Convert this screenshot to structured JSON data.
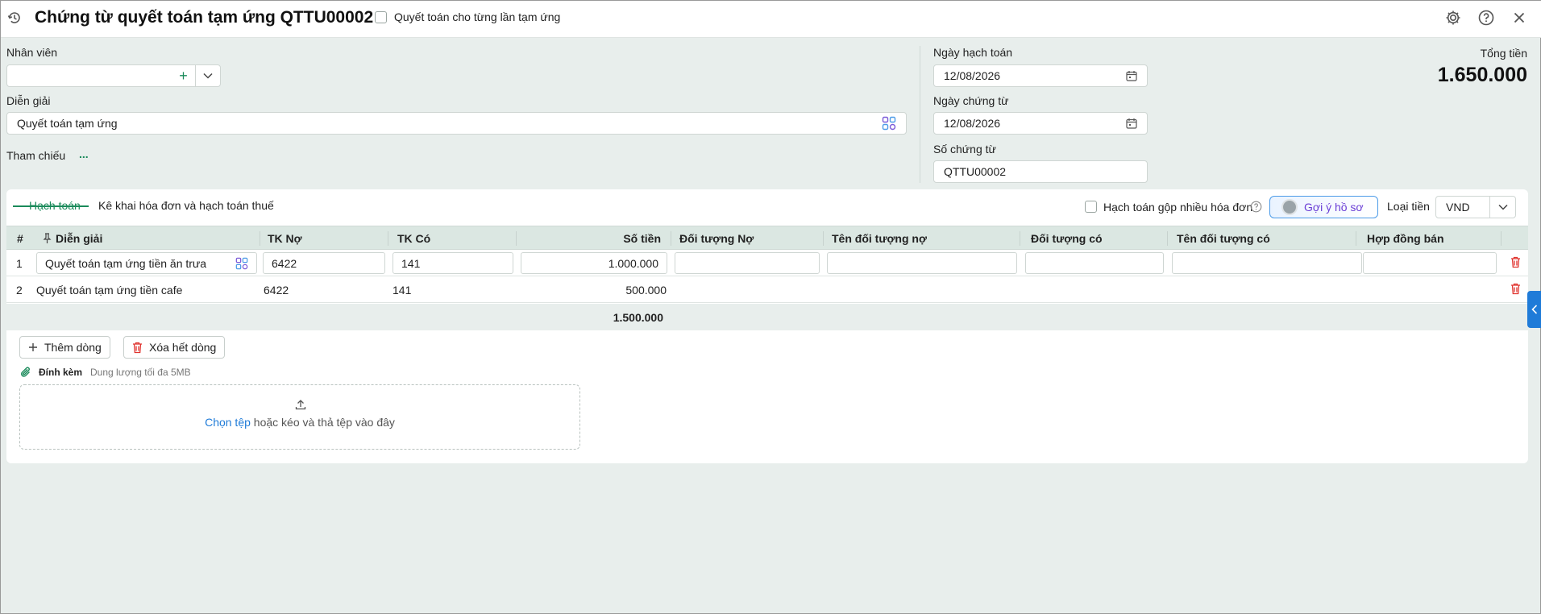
{
  "header": {
    "title": "Chứng từ quyết toán tạm ứng QTTU00002",
    "checkbox_label": "Quyết toán cho từng lần tạm ứng"
  },
  "form": {
    "employee_label": "Nhân viên",
    "employee_value": "",
    "description_label": "Diễn giải",
    "description_value": "Quyết toán tạm ứng",
    "reference_label": "Tham chiếu",
    "reference_more": "...",
    "posting_date_label": "Ngày hạch toán",
    "posting_date_value": "12/08/2026",
    "voucher_date_label": "Ngày chứng từ",
    "voucher_date_value": "12/08/2026",
    "voucher_no_label": "Số chứng từ",
    "voucher_no_value": "QTTU00002",
    "total_label": "Tổng tiền",
    "total_value": "1.650.000"
  },
  "tabs": [
    {
      "label": "Hạch toán"
    },
    {
      "label": "Kê khai hóa đơn và hạch toán thuế"
    }
  ],
  "toolbar": {
    "merge_label": "Hạch toán gộp nhiều hóa đơn",
    "suggest_label": "Gợi ý hồ sơ",
    "currency_label": "Loại tiền",
    "currency_value": "VND"
  },
  "table": {
    "headers": [
      "#",
      "Diễn giải",
      "TK Nợ",
      "TK Có",
      "Số tiền",
      "Đối tượng Nợ",
      "Tên đối tượng nợ",
      "Đối tượng có",
      "Tên đối tượng có",
      "Hợp đồng bán"
    ],
    "rows": [
      {
        "no": "1",
        "desc": "Quyết toán tạm ứng tiền ăn trưa",
        "debit": "6422",
        "credit": "141",
        "amount": "1.000.000"
      },
      {
        "no": "2",
        "desc": "Quyết toán tạm ứng tiền cafe",
        "debit": "6422",
        "credit": "141",
        "amount": "500.000"
      }
    ],
    "sum_amount": "1.500.000"
  },
  "actions": {
    "add_row": "Thêm dòng",
    "delete_all": "Xóa hết dòng"
  },
  "attachment": {
    "label": "Đính kèm",
    "hint": "Dung lượng tối đa 5MB",
    "choose": "Chọn tệp",
    "drop_text": " hoặc kéo và thả tệp vào đây"
  },
  "colors": {
    "accent_green": "#1a8a5a",
    "link_blue": "#1f7bd8",
    "delete_red": "#e0342f"
  }
}
